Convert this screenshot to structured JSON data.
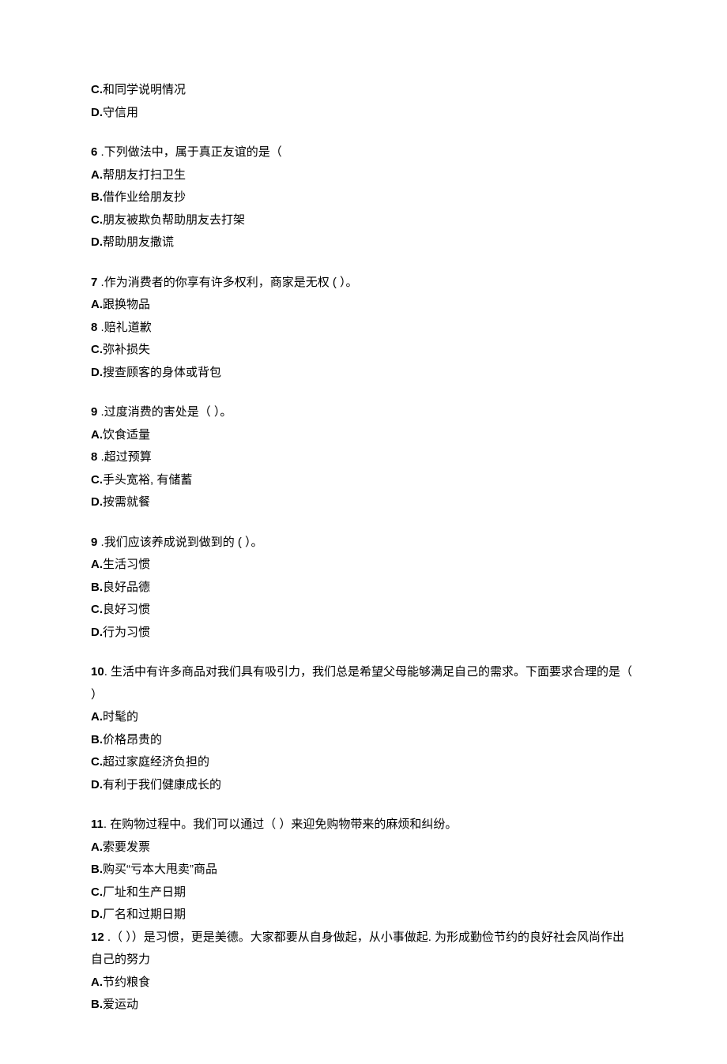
{
  "q5_tail": {
    "optC": {
      "letter": "C.",
      "text": "和同学说明情况"
    },
    "optD": {
      "letter": "D.",
      "text": "守信用"
    }
  },
  "q6": {
    "num": "6",
    "sep": " .",
    "stem": "下列做法中，属于真正友谊的是（",
    "optA": {
      "letter": "A.",
      "text": "帮朋友打扫卫生"
    },
    "optB": {
      "letter": "B.",
      "text": "借作业给朋友抄"
    },
    "optC": {
      "letter": "C.",
      "text": "朋友被欺负帮助朋友去打架"
    },
    "optD": {
      "letter": "D.",
      "text": "帮助朋友撒谎"
    }
  },
  "q7": {
    "num": "7",
    "sep": " .",
    "stem": "作为消费者的你享有许多权利，商家是无权 (          ）。",
    "optA": {
      "letter": "A.",
      "text": "跟换物品"
    },
    "optB": {
      "letter": "8",
      "sep": "  .",
      "text": "赔礼道歉"
    },
    "optC": {
      "letter": "C.",
      "text": "弥补损失"
    },
    "optD": {
      "letter": "D.",
      "text": "搜查顾客的身体或背包"
    }
  },
  "q8": {
    "num": "9",
    "sep": "  .",
    "stem": "过度消费的害处是（    ）。",
    "optA": {
      "letter": "A.",
      "text": "饮食适量"
    },
    "optB": {
      "letter": "8",
      "sep": "  .",
      "text": "超过预算"
    },
    "optC": {
      "letter": "C.",
      "text": "手头宽裕, 有储蓄"
    },
    "optD": {
      "letter": "D.",
      "text": "按需就餐"
    }
  },
  "q9": {
    "num": "9",
    "sep": "  .",
    "stem": "我们应该养成说到做到的 (          ）。",
    "optA": {
      "letter": "A.",
      "text": "生活习惯"
    },
    "optB": {
      "letter": "B.",
      "text": "良好品德"
    },
    "optC": {
      "letter": "C.",
      "text": "良好习惯"
    },
    "optD": {
      "letter": "D.",
      "text": "行为习惯"
    }
  },
  "q10": {
    "num": "10",
    "sep": ". ",
    "stem": "生活中有许多商品对我们具有吸引力，我们总是希望父母能够满足自己的需求。下面要求合理的是（                    ）",
    "optA": {
      "letter": "A.",
      "text": "时髦的"
    },
    "optB": {
      "letter": "B.",
      "text": "价格昂贵的"
    },
    "optC": {
      "letter": "C.",
      "text": "超过家庭经济负担的"
    },
    "optD": {
      "letter": "D.",
      "text": "有利于我们健康成长的"
    }
  },
  "q11": {
    "num": "11",
    "sep": ". ",
    "stem": "在购物过程中。我们可以通过（        ）来迎免购物带来的麻烦和纠纷。",
    "optA": {
      "letter": "A.",
      "text": "索要发票"
    },
    "optB": {
      "letter": "B.",
      "text": "购买“亏本大甩卖”商品"
    },
    "optC": {
      "letter": "C.",
      "text": "厂址和生产日期"
    },
    "optD": {
      "letter": "D.",
      "text": "厂名和过期日期"
    }
  },
  "q12": {
    "num": "12",
    "sep": "  .",
    "stem": "（          ））是习惯，更是美德。大家都要从自身做起，从小事做起. 为形成勤俭节约的良好社会风尚作出自己的努力",
    "optA": {
      "letter": "A.",
      "text": "节约粮食"
    },
    "optB": {
      "letter": "B.",
      "text": "爱运动"
    }
  }
}
